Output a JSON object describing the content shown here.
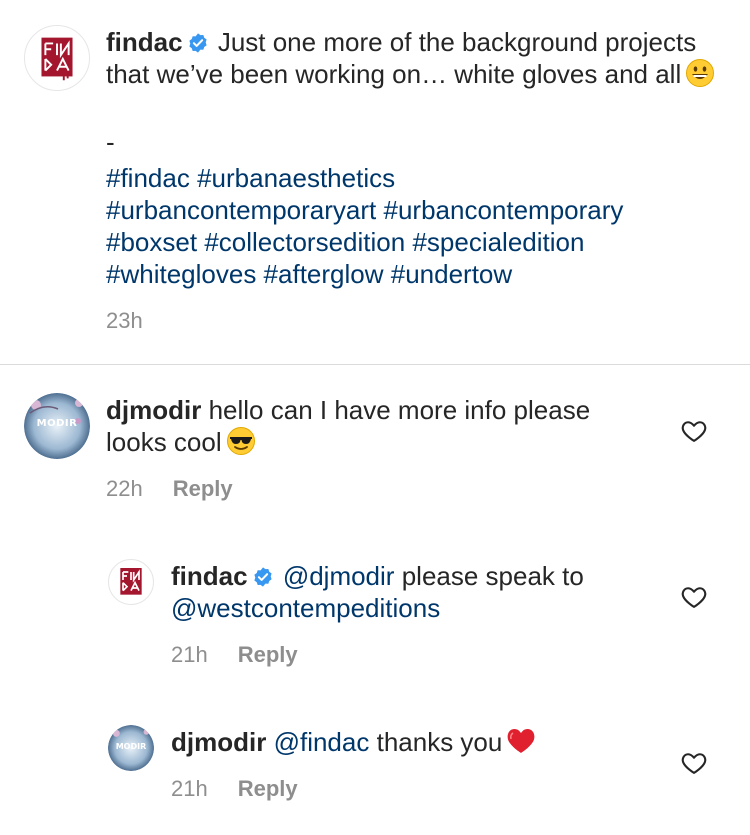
{
  "caption": {
    "username": "findac",
    "text_line": "Just one more of the background projects that we’ve been working on… white gloves and all",
    "emoji": "grinning-face",
    "dash": "-",
    "hashtags": [
      "#findac",
      "#urbanaesthetics",
      "#urbancontemporaryart",
      "#urbancontemporary",
      "#boxset",
      "#collectorsedition",
      "#specialedition",
      "#whitegloves",
      "#afterglow",
      "#undertow"
    ],
    "time": "23h"
  },
  "comments": [
    {
      "username": "djmodir",
      "text": "hello can I have more info please looks cool",
      "emoji": "smiling-face-with-sunglasses",
      "time": "22h",
      "reply_label": "Reply",
      "avatar_text": "MODIR"
    },
    {
      "username": "findac",
      "mention": "@djmodir",
      "text": "please speak to",
      "mention2": "@westcontempeditions",
      "time": "21h",
      "reply_label": "Reply"
    },
    {
      "username": "djmodir",
      "mention": "@findac",
      "text": "thanks you",
      "emoji": "red-heart",
      "time": "21h",
      "reply_label": "Reply",
      "avatar_text": "MODIR"
    }
  ],
  "colors": {
    "text": "#262626",
    "link": "#00376b",
    "meta": "#8e8e8e",
    "verified": "#3897f0",
    "brand": "#a3162d"
  }
}
